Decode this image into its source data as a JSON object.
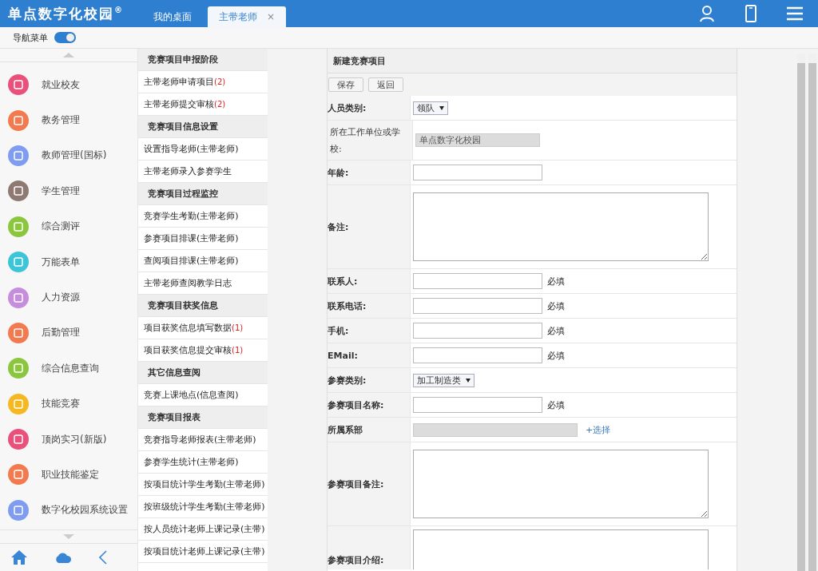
{
  "header": {
    "logo": "单点数字化校园",
    "logo_mark": "®",
    "tabs": [
      {
        "label": "我的桌面",
        "selected": false,
        "closable": false
      },
      {
        "label": "主带老师",
        "selected": true,
        "closable": true,
        "close": "×"
      }
    ]
  },
  "nav_toggle": {
    "label": "导航菜单",
    "on": true
  },
  "sidebar": {
    "items": [
      {
        "label": "就业校友",
        "color": "#e9507a"
      },
      {
        "label": "教务管理",
        "color": "#f27a4e"
      },
      {
        "label": "教师管理(国标)",
        "color": "#7f9cf0"
      },
      {
        "label": "学生管理",
        "color": "#8e7a72"
      },
      {
        "label": "综合测评",
        "color": "#8cc63f"
      },
      {
        "label": "万能表单",
        "color": "#3cc4d8"
      },
      {
        "label": "人力资源",
        "color": "#c58ddc"
      },
      {
        "label": "后勤管理",
        "color": "#f27a4e"
      },
      {
        "label": "综合信息查询",
        "color": "#8cc63f"
      },
      {
        "label": "技能竞赛",
        "color": "#f5b820"
      },
      {
        "label": "顶岗实习(新版)",
        "color": "#e9507a"
      },
      {
        "label": "职业技能鉴定",
        "color": "#f27a4e"
      },
      {
        "label": "数字化校园系统设置",
        "color": "#7f9cf0"
      }
    ]
  },
  "menu": [
    {
      "kind": "heading",
      "label": "竞赛项目申报阶段"
    },
    {
      "kind": "item",
      "label": "主带老师申请项目",
      "count": "(2)"
    },
    {
      "kind": "item",
      "label": "主带老师提交审核",
      "count": "(2)"
    },
    {
      "kind": "heading",
      "label": "竞赛项目信息设置"
    },
    {
      "kind": "item",
      "label": "设置指导老师(主带老师)"
    },
    {
      "kind": "item",
      "label": "主带老师录入参赛学生"
    },
    {
      "kind": "heading",
      "label": "竞赛项目过程监控"
    },
    {
      "kind": "item",
      "label": "竞赛学生考勤(主带老师)"
    },
    {
      "kind": "item",
      "label": "参赛项目排课(主带老师)"
    },
    {
      "kind": "item",
      "label": "查阅项目排课(主带老师)"
    },
    {
      "kind": "item",
      "label": "主带老师查阅教学日志"
    },
    {
      "kind": "heading",
      "label": "竞赛项目获奖信息"
    },
    {
      "kind": "item",
      "label": "项目获奖信息填写数据",
      "count": "(1)"
    },
    {
      "kind": "item",
      "label": "项目获奖信息提交审核",
      "count": "(1)"
    },
    {
      "kind": "heading",
      "label": "其它信息查阅"
    },
    {
      "kind": "item",
      "label": "竞赛上课地点(信息查阅)"
    },
    {
      "kind": "heading",
      "label": "竞赛项目报表"
    },
    {
      "kind": "item",
      "label": "竞赛指导老师报表(主带老师)"
    },
    {
      "kind": "item",
      "label": "参赛学生统计(主带老师)"
    },
    {
      "kind": "item",
      "label": "按项目统计学生考勤(主带老师)"
    },
    {
      "kind": "item",
      "label": "按班级统计学生考勤(主带老师)"
    },
    {
      "kind": "item",
      "label": "按人员统计老师上课记录(主带)"
    },
    {
      "kind": "item",
      "label": "按项目统计老师上课记录(主带)"
    }
  ],
  "form": {
    "title": "新建竞赛项目",
    "buttons": [
      "保存",
      "返回"
    ],
    "rows": [
      {
        "kind": "select",
        "label": "人员类别:",
        "value": "领队"
      },
      {
        "kind": "readonly",
        "label": "所在工作单位或学校:",
        "value": "单点数字化校园"
      },
      {
        "kind": "input",
        "label": "年龄:"
      },
      {
        "kind": "textarea",
        "label": "备注:"
      },
      {
        "kind": "input",
        "label": "联系人:",
        "note": "必填"
      },
      {
        "kind": "input",
        "label": "联系电话:",
        "note": "必填"
      },
      {
        "kind": "input",
        "label": "手机:",
        "note": "必填"
      },
      {
        "kind": "input",
        "label": "EMail:",
        "note": "必填"
      },
      {
        "kind": "select",
        "label": "参赛类别:",
        "value": "加工制造类"
      },
      {
        "kind": "input",
        "label": "参赛项目名称:",
        "note": "必填"
      },
      {
        "kind": "picker",
        "label": "所属系部",
        "link": "+选择"
      },
      {
        "kind": "textarea",
        "label": "参赛项目备注:"
      },
      {
        "kind": "textarea_cut",
        "label": "参赛项目介绍:"
      }
    ]
  }
}
